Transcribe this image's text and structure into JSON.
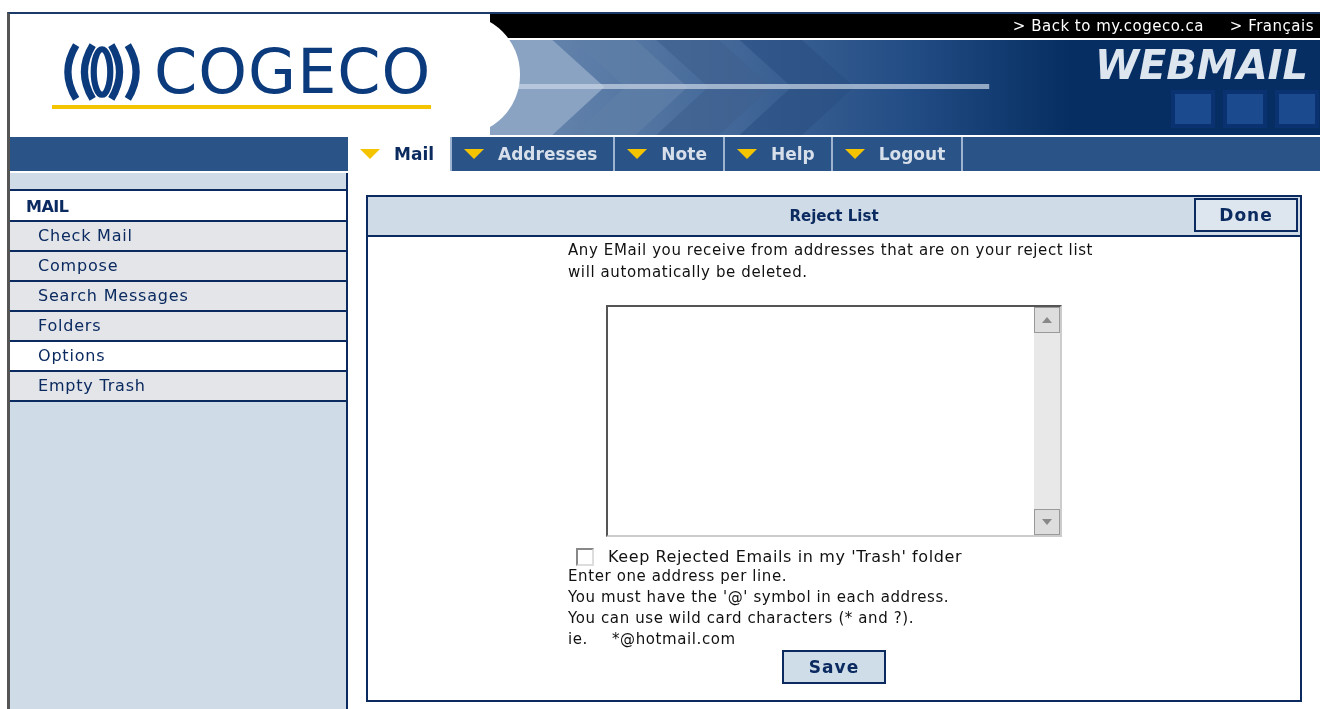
{
  "header": {
    "logo": "COGECO",
    "links": [
      "> Back to my.cogeco.ca",
      "> Français"
    ],
    "product": "WEBMAIL"
  },
  "tabs": [
    {
      "label": "Mail",
      "selected": true
    },
    {
      "label": "Addresses",
      "selected": false
    },
    {
      "label": "Note",
      "selected": false
    },
    {
      "label": "Help",
      "selected": false
    },
    {
      "label": "Logout",
      "selected": false
    }
  ],
  "sidebar": {
    "heading": "MAIL",
    "items": [
      {
        "label": "Check Mail",
        "selected": false
      },
      {
        "label": "Compose",
        "selected": false
      },
      {
        "label": "Search Messages",
        "selected": false
      },
      {
        "label": "Folders",
        "selected": false
      },
      {
        "label": "Options",
        "selected": true
      },
      {
        "label": "Empty Trash",
        "selected": false
      }
    ]
  },
  "panel": {
    "title": "Reject List",
    "done_button": "Done",
    "intro": "Any EMail you receive from addresses that are on your reject list will automatically be deleted.",
    "checkbox": {
      "label": "Keep Rejected Emails in my 'Trash' folder",
      "checked": false
    },
    "notes": [
      "Enter one address per line.",
      "You must have the '@' symbol in each address.",
      "You can use wild card characters (* and ?)."
    ],
    "example_label": "ie.",
    "example": "*@hotmail.com",
    "save_button": "Save"
  }
}
